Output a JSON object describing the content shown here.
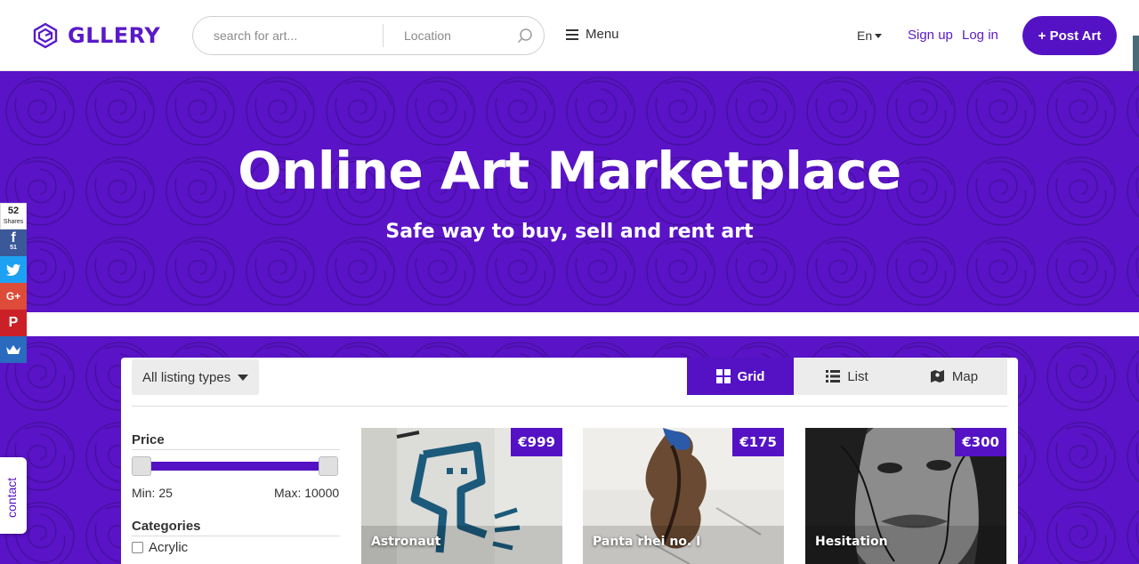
{
  "header": {
    "logo_text": "GLLERY",
    "search_placeholder": "search for art...",
    "location_placeholder": "Location",
    "menu_label": "Menu",
    "language": "En",
    "signup_label": "Sign up",
    "login_label": "Log in",
    "post_art_label": "+ Post Art"
  },
  "hero": {
    "title": "Online Art Marketplace",
    "subtitle": "Safe way to buy, sell and rent art"
  },
  "toolbar": {
    "listing_types_label": "All listing types",
    "views": [
      {
        "label": "Grid",
        "icon": "grid-icon",
        "active": true
      },
      {
        "label": "List",
        "icon": "list-icon",
        "active": false
      },
      {
        "label": "Map",
        "icon": "map-icon",
        "active": false
      }
    ]
  },
  "filters": {
    "price_title": "Price",
    "price_min_label": "Min: 25",
    "price_max_label": "Max: 10000",
    "categories_title": "Categories",
    "categories": [
      "Acrylic"
    ]
  },
  "listings": [
    {
      "title": "Astronaut",
      "price": "€999"
    },
    {
      "title": "Panta rhei no. I",
      "price": "€175"
    },
    {
      "title": "Hesitation",
      "price": "€300"
    }
  ],
  "share": {
    "total_count": "52",
    "total_label": "Shares",
    "facebook_count": "51"
  },
  "contact_label": "contact",
  "colors": {
    "brand_purple": "#5412c4",
    "hero_purple": "#5a13c6"
  }
}
